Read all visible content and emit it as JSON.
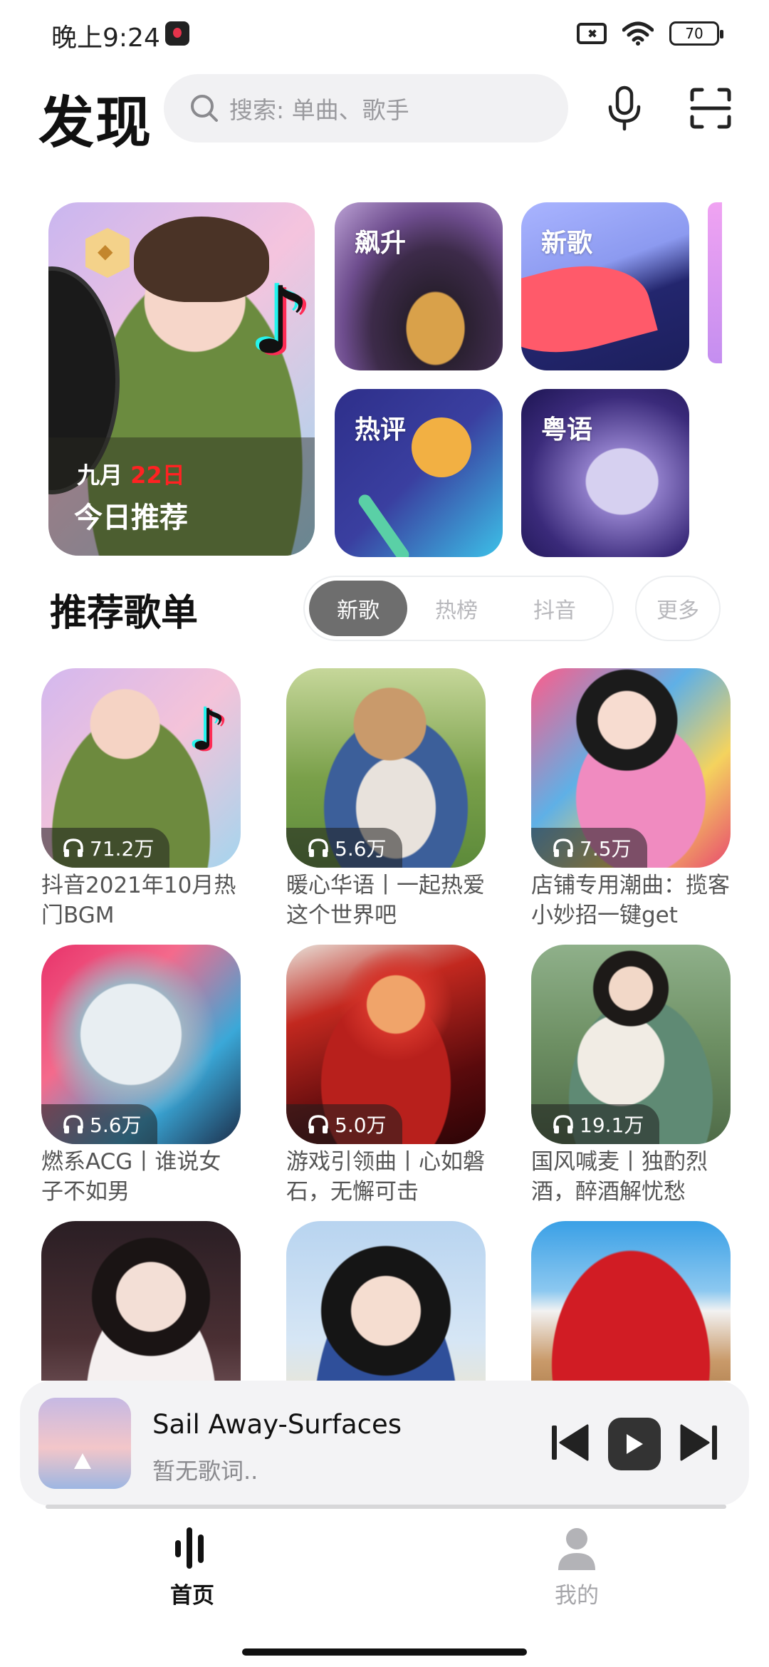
{
  "status_bar": {
    "time": "晚上9:24",
    "battery": "70",
    "icons": [
      "music-app-icon",
      "sim-off-icon",
      "wifi-icon",
      "battery-icon"
    ]
  },
  "header": {
    "title": "发现",
    "search_placeholder": "搜索: 单曲、歌手",
    "icons": [
      "search-icon",
      "mic-icon",
      "scan-icon"
    ]
  },
  "banner": {
    "month": "九月",
    "day": "22日",
    "title": "今日推荐",
    "day_color": "#ff2222"
  },
  "categories": [
    {
      "label": "飙升"
    },
    {
      "label": "新歌"
    },
    {
      "label": "热评"
    },
    {
      "label": "粤语"
    }
  ],
  "recommend": {
    "title": "推荐歌单",
    "filters": [
      "新歌",
      "热榜",
      "抖音"
    ],
    "active_filter": "新歌",
    "more": "更多"
  },
  "playlists": [
    {
      "plays": "71.2万",
      "title": "抖音2021年10月热门BGM"
    },
    {
      "plays": "5.6万",
      "title": "暖心华语丨一起热爱这个世界吧"
    },
    {
      "plays": "7.5万",
      "title": "店铺专用潮曲：揽客小妙招一键get"
    },
    {
      "plays": "5.6万",
      "title": "燃系ACG丨谁说女子不如男"
    },
    {
      "plays": "5.0万",
      "title": "游戏引领曲丨心如磐石，无懈可击"
    },
    {
      "plays": "19.1万",
      "title": "国风喊麦丨独酌烈酒，醉酒解忧愁"
    },
    {
      "plays": "",
      "title": ""
    },
    {
      "plays": "",
      "title": ""
    },
    {
      "plays": "",
      "title": ""
    }
  ],
  "player": {
    "song": "Sail Away-Surfaces",
    "lyric": "暂无歌词..",
    "progress": 0.0
  },
  "nav": {
    "home": "首页",
    "mine": "我的",
    "active": "home"
  }
}
